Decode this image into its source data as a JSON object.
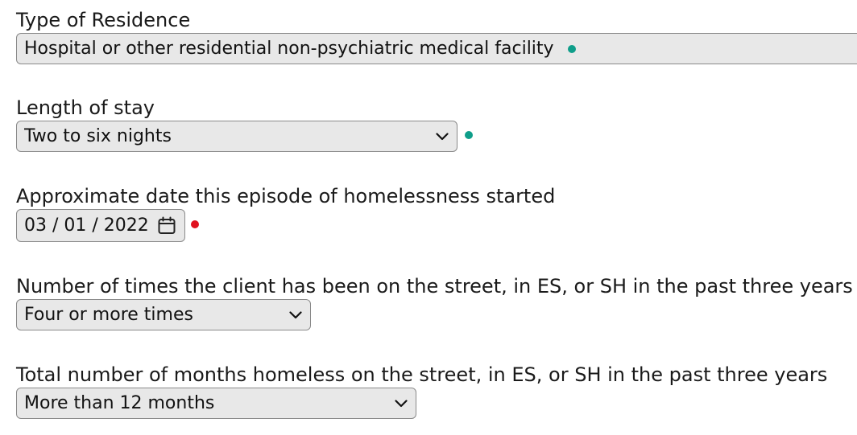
{
  "colors": {
    "valid_dot": "#0f9e8a",
    "invalid_dot": "#e0111f"
  },
  "fields": {
    "residence": {
      "label": "Type of Residence",
      "value": "Hospital or other residential non-psychiatric medical facility",
      "status": "valid"
    },
    "length_of_stay": {
      "label": "Length of stay",
      "value": "Two to six nights",
      "status": "valid",
      "icon": "chevron-down-icon"
    },
    "date_started": {
      "label": "Approximate date this episode of homelessness started",
      "value": "03 / 01 / 2022",
      "status": "invalid",
      "icon": "calendar-icon"
    },
    "times_on_street": {
      "label": "Number of times the client has been on the street, in ES, or SH in the past three years",
      "value": "Four or more times",
      "icon": "chevron-down-icon"
    },
    "months_homeless": {
      "label": "Total number of months homeless on the street, in ES, or SH in the past three years",
      "value": "More than 12 months",
      "icon": "chevron-down-icon"
    }
  }
}
